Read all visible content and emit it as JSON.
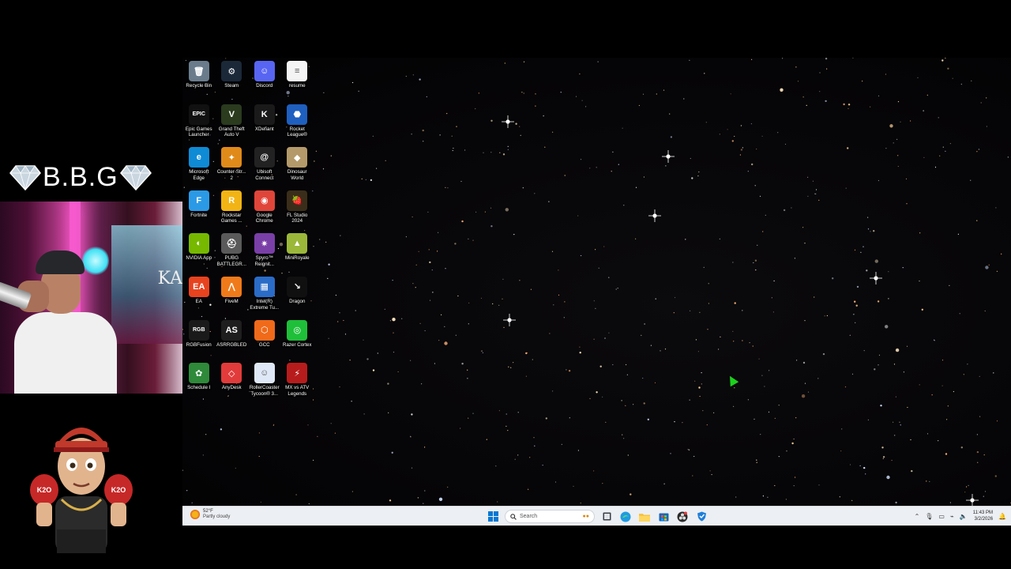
{
  "overlay": {
    "brand_name": "B.B.G",
    "webcam_sign_text": "KA",
    "mascot_glove_text": "K2O"
  },
  "desktop": {
    "icons": [
      {
        "label": "Recycle Bin",
        "icon": "recycle-bin-icon",
        "color": "#6a7c8c",
        "glyph": "🗑"
      },
      {
        "label": "Steam",
        "icon": "steam-icon",
        "color": "#1b2838",
        "glyph": "⚙"
      },
      {
        "label": "Discord",
        "icon": "discord-icon",
        "color": "#5865f2",
        "glyph": "☺"
      },
      {
        "label": "resume",
        "icon": "document-icon",
        "color": "#f4f4f4",
        "glyph": "≡"
      },
      {
        "label": "Epic Games\nLauncher",
        "icon": "epic-games-icon",
        "color": "#111111",
        "glyph": "EPIC"
      },
      {
        "label": "Grand Theft\nAuto V",
        "icon": "gta-v-icon",
        "color": "#2a3b1e",
        "glyph": "V"
      },
      {
        "label": "XDefiant",
        "icon": "xdefiant-icon",
        "color": "#1a1a1a",
        "glyph": "K"
      },
      {
        "label": "Rocket\nLeague®",
        "icon": "rocket-league-icon",
        "color": "#1f5fbf",
        "glyph": "⬣"
      },
      {
        "label": "Microsoft\nEdge",
        "icon": "edge-icon",
        "color": "#0f8bd6",
        "glyph": "e"
      },
      {
        "label": "Counter-Str...\n2",
        "icon": "counter-strike-icon",
        "color": "#e08a1a",
        "glyph": "✦"
      },
      {
        "label": "Ubisoft\nConnect",
        "icon": "ubisoft-icon",
        "color": "#222222",
        "glyph": "@"
      },
      {
        "label": "Dinosaur\nWorld",
        "icon": "dinosaur-world-icon",
        "color": "#b49a6a",
        "glyph": "◆"
      },
      {
        "label": "Fortnite",
        "icon": "fortnite-icon",
        "color": "#2b9ae6",
        "glyph": "F"
      },
      {
        "label": "Rockstar\nGames ...",
        "icon": "rockstar-icon",
        "color": "#f2b414",
        "glyph": "R"
      },
      {
        "label": "Google\nChrome",
        "icon": "chrome-icon",
        "color": "#e0453a",
        "glyph": "◉"
      },
      {
        "label": "FL Studio\n2024",
        "icon": "fl-studio-icon",
        "color": "#3a2e1a",
        "glyph": "🍓"
      },
      {
        "label": "NVIDIA App",
        "icon": "nvidia-icon",
        "color": "#76b900",
        "glyph": "◐"
      },
      {
        "label": "PUBG\nBATTLEGR...",
        "icon": "pubg-icon",
        "color": "#5a5a5a",
        "glyph": "⛑"
      },
      {
        "label": "Spyro™\nReignit...",
        "icon": "spyro-icon",
        "color": "#7b3fa8",
        "glyph": "✷"
      },
      {
        "label": "MiniRoyale",
        "icon": "miniroyale-icon",
        "color": "#9bb83a",
        "glyph": "▲"
      },
      {
        "label": "EA",
        "icon": "ea-icon",
        "color": "#e8431f",
        "glyph": "EA"
      },
      {
        "label": "FiveM",
        "icon": "fivem-icon",
        "color": "#f07a1a",
        "glyph": "⋀"
      },
      {
        "label": "Intel(R)\nExtreme Tu...",
        "icon": "intel-xtu-icon",
        "color": "#2a6cc8",
        "glyph": "▦"
      },
      {
        "label": "Dragon",
        "icon": "dragon-icon",
        "color": "#101010",
        "glyph": "↘"
      },
      {
        "label": "RGBFusion",
        "icon": "rgbfusion-icon",
        "color": "#1a1a1a",
        "glyph": "RGB"
      },
      {
        "label": "ASRRGBLED",
        "icon": "asrock-rgb-icon",
        "color": "#1e1e1e",
        "glyph": "AS"
      },
      {
        "label": "GCC",
        "icon": "gcc-icon",
        "color": "#f06a1a",
        "glyph": "⬡"
      },
      {
        "label": "Razer Cortex",
        "icon": "razer-cortex-icon",
        "color": "#1fbf3a",
        "glyph": "◎"
      },
      {
        "label": "Schedule I",
        "icon": "schedule-one-icon",
        "color": "#2f8a3a",
        "glyph": "✿"
      },
      {
        "label": "AnyDesk",
        "icon": "anydesk-icon",
        "color": "#e23b3b",
        "glyph": "◇"
      },
      {
        "label": "RollerCoaster\nTycoon® 3...",
        "icon": "rollercoaster-tycoon-icon",
        "color": "#dfe8f6",
        "glyph": "☺"
      },
      {
        "label": "MX vs ATV\nLegends",
        "icon": "mx-vs-atv-icon",
        "color": "#b71c1c",
        "glyph": "⚡"
      }
    ]
  },
  "taskbar": {
    "weather_temp": "52°F",
    "weather_desc": "Partly cloudy",
    "search_placeholder": "Search",
    "clock_time": "11:43 PM",
    "clock_date": "3/2/2026"
  },
  "colors": {
    "taskbar_bg": "#eceff3",
    "windows_blue": "#0078d4",
    "cursor_green": "#1cd11c"
  }
}
